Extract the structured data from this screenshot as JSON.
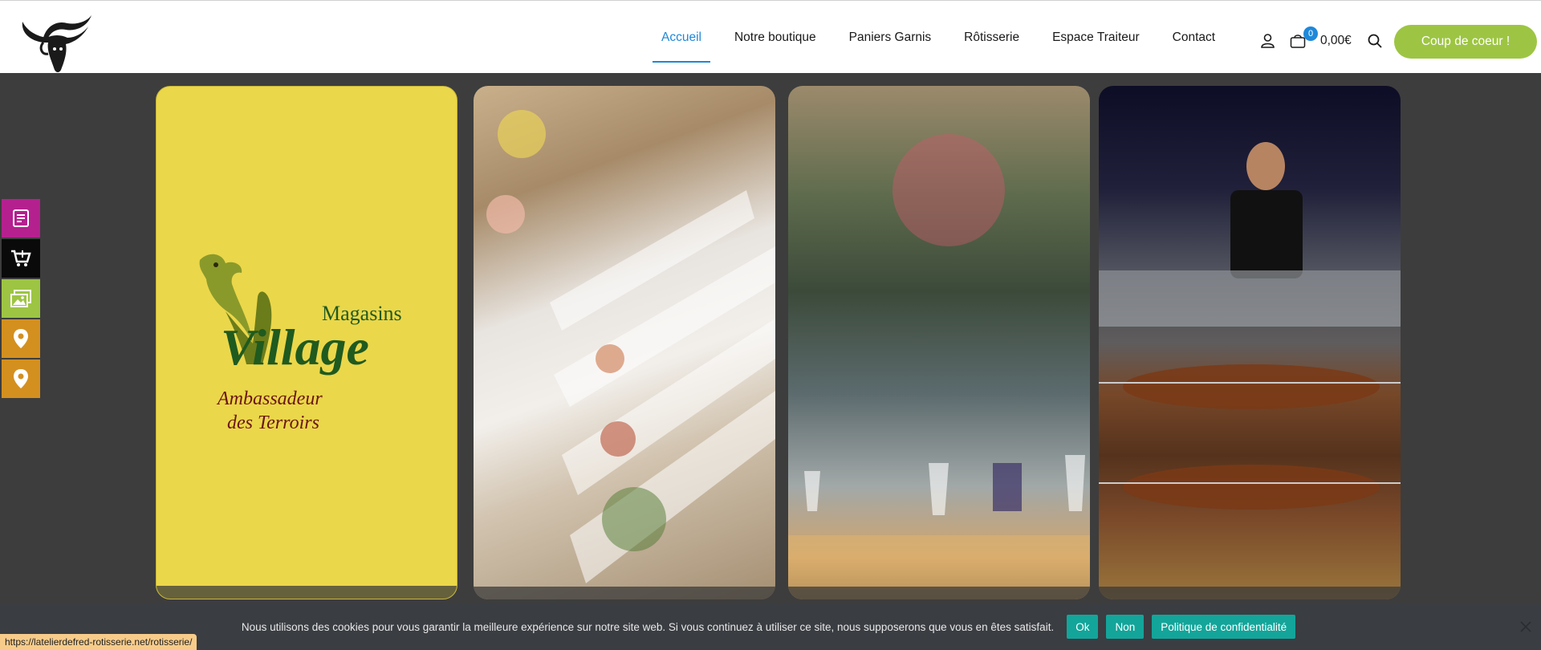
{
  "header": {
    "nav": [
      {
        "label": "Accueil",
        "active": true
      },
      {
        "label": "Notre boutique",
        "active": false
      },
      {
        "label": "Paniers Garnis",
        "active": false
      },
      {
        "label": "Rôtisserie",
        "active": false
      },
      {
        "label": "Espace Traiteur",
        "active": false
      },
      {
        "label": "Contact",
        "active": false
      }
    ],
    "cart_count": "0",
    "cart_total": "0,00€",
    "cta_label": "Coup de coeur !",
    "icons": [
      "user-icon",
      "cart-icon",
      "search-icon"
    ]
  },
  "sidebar": [
    {
      "icon": "menu-card-icon",
      "color": "#b5208f"
    },
    {
      "icon": "add-to-cart-icon",
      "color": "#0a0a0a"
    },
    {
      "icon": "gallery-icon",
      "color": "#9dc543"
    },
    {
      "icon": "location-pin-icon",
      "color": "#d4901f"
    },
    {
      "icon": "location-pin-icon",
      "color": "#d4901f"
    }
  ],
  "cards": {
    "village": {
      "line1": "Magasins",
      "line2": "Village",
      "line3": "Ambassadeur",
      "line4": "des Terroirs"
    }
  },
  "cookie": {
    "text": "Nous utilisons des cookies pour vous garantir la meilleure expérience sur notre site web. Si vous continuez à utiliser ce site, nous supposerons que vous en êtes satisfait.",
    "ok": "Ok",
    "non": "Non",
    "policy": "Politique de confidentialité"
  },
  "status_url": "https://latelierdefred-rotisserie.net/rotisserie/",
  "colors": {
    "accent": "#1e88d9",
    "cta": "#9dc543",
    "cookie_btn": "#13a59a"
  }
}
